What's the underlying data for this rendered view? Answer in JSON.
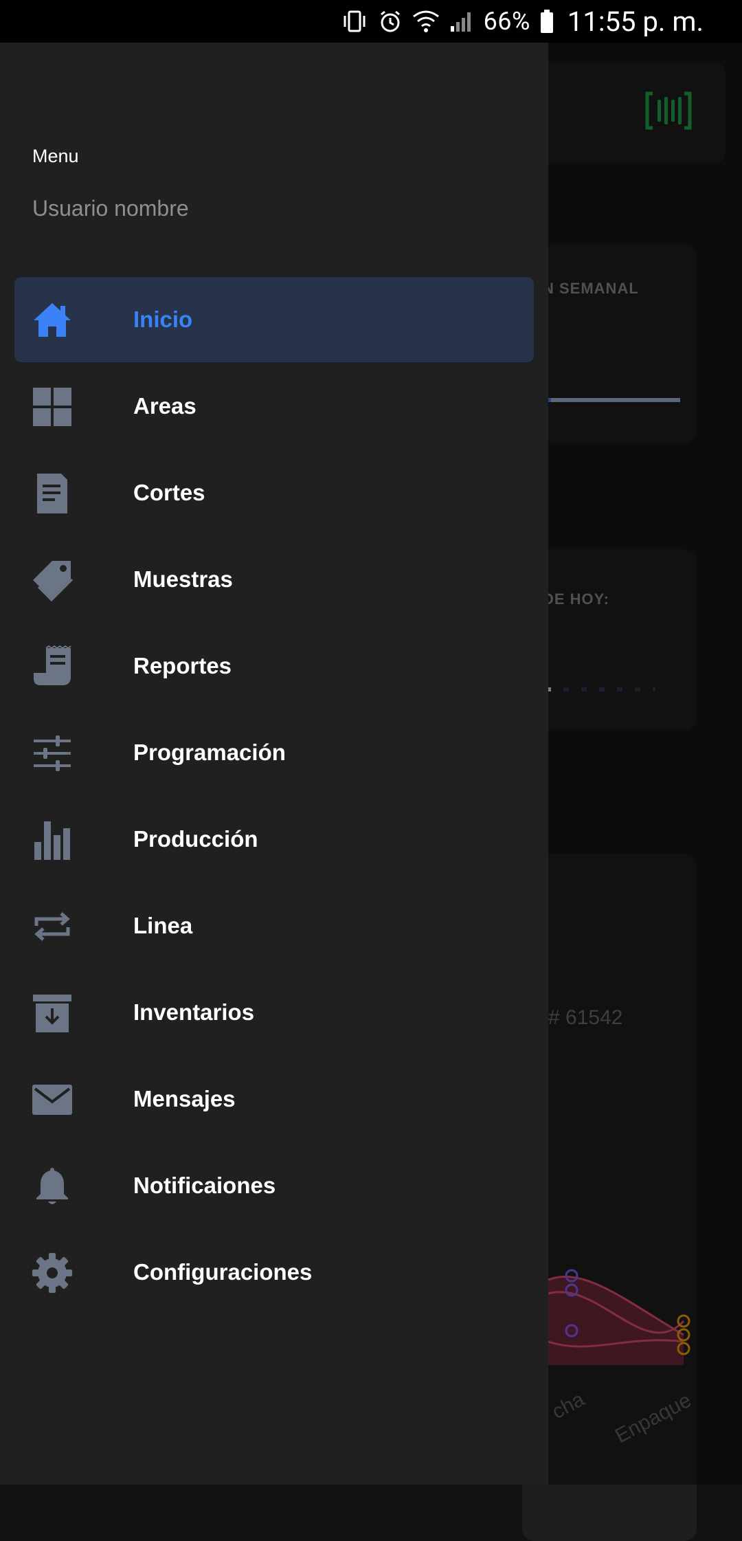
{
  "status_bar": {
    "battery_percent": "66%",
    "time": "11:55 p. m."
  },
  "background": {
    "card1_label": "N SEMANAL",
    "card2_label": "DE HOY:",
    "card3_number": "# 61542",
    "chart_axis_labels": [
      "cha",
      "Enpaque"
    ]
  },
  "drawer": {
    "title": "Menu",
    "user_name": "Usuario nombre",
    "active_color": "#3b82f6",
    "items": [
      {
        "label": "Inicio",
        "icon": "home-icon"
      },
      {
        "label": "Areas",
        "icon": "grid-icon"
      },
      {
        "label": "Cortes",
        "icon": "document-icon"
      },
      {
        "label": "Muestras",
        "icon": "tag-icon"
      },
      {
        "label": "Reportes",
        "icon": "receipt-icon"
      },
      {
        "label": "Programación",
        "icon": "sliders-icon"
      },
      {
        "label": "Producción",
        "icon": "bar-chart-icon"
      },
      {
        "label": "Linea",
        "icon": "repeat-icon"
      },
      {
        "label": "Inventarios",
        "icon": "archive-icon"
      },
      {
        "label": "Mensajes",
        "icon": "mail-icon"
      },
      {
        "label": "Notificaiones",
        "icon": "bell-icon"
      },
      {
        "label": "Configuraciones",
        "icon": "gear-icon"
      }
    ]
  }
}
